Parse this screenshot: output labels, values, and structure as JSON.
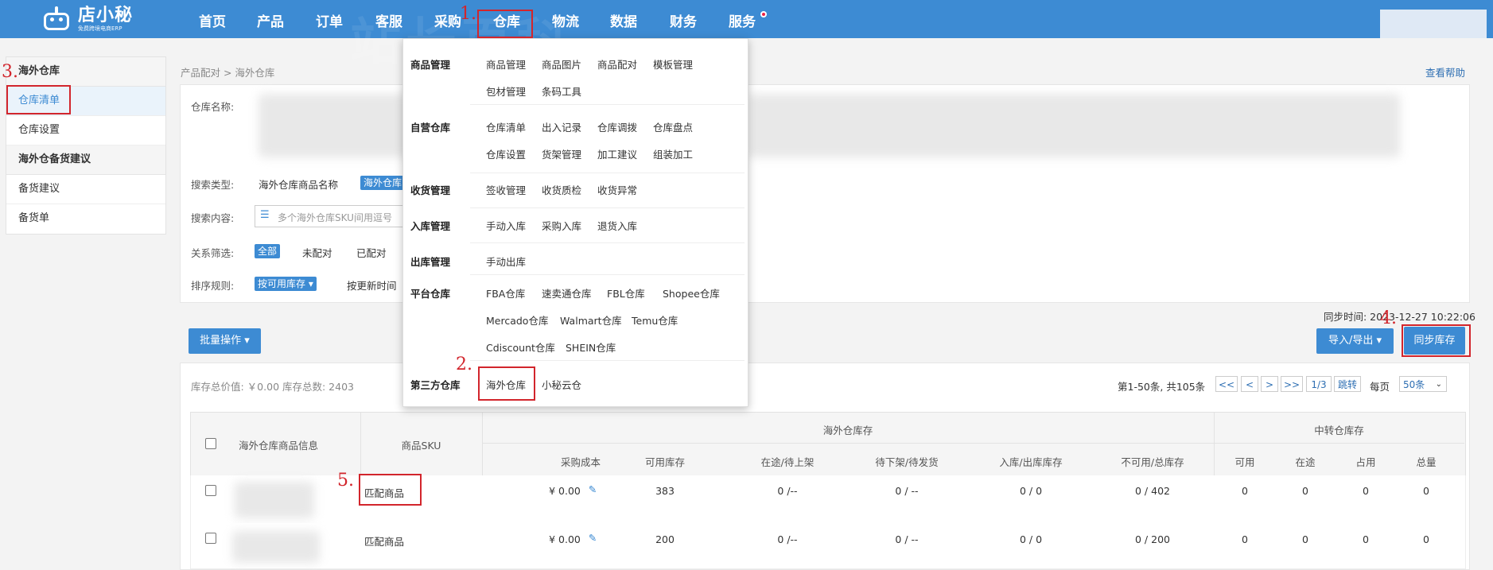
{
  "app": {
    "logo_name": "店小秘",
    "logo_tagline": "免费跨境电商ERP"
  },
  "nav": {
    "items": [
      "首页",
      "产品",
      "订单",
      "客服",
      "采购",
      "仓库",
      "物流",
      "数据",
      "财务",
      "服务"
    ],
    "active": "仓库"
  },
  "annotations": [
    "1.",
    "2.",
    "3.",
    "4.",
    "5."
  ],
  "sidebar": {
    "group1_title": "海外仓库",
    "group1_items": [
      "仓库清单",
      "仓库设置"
    ],
    "group2_title": "海外仓备货建议",
    "group2_items": [
      "备货建议",
      "备货单"
    ]
  },
  "breadcrumb": "产品配对 > 海外仓库",
  "help_link": "查看帮助",
  "filters": {
    "warehouse_name_label": "仓库名称:",
    "search_type_label": "搜索类型:",
    "search_type_option1": "海外仓库商品名称",
    "search_type_option2": "海外仓库",
    "search_content_label": "搜索内容:",
    "search_placeholder": "多个海外仓库SKU间用逗号",
    "relation_label": "关系筛选:",
    "relation_options": [
      "全部",
      "未配对",
      "已配对"
    ],
    "sort_label": "排序规则:",
    "sort_selected": "按可用库存 ▾",
    "sort_option2": "按更新时间"
  },
  "sync_time": "同步时间: 2023-12-27 10:22:06",
  "actions": {
    "batch": "批量操作 ▾",
    "import_export": "导入/导出 ▾",
    "sync_stock": "同步库存"
  },
  "summary": "库存总价值: ￥0.00 库存总数: 2403",
  "pager": {
    "range": "第1-50条, 共105条",
    "buttons": [
      "<<",
      "<",
      ">",
      ">>",
      "1/3",
      "跳转"
    ],
    "per_page_label": "每页",
    "per_page_value": "50条"
  },
  "dropdown": {
    "categories": [
      {
        "name": "商品管理",
        "items": [
          "商品管理",
          "商品图片",
          "商品配对",
          "模板管理",
          "包材管理",
          "条码工具"
        ]
      },
      {
        "name": "自营仓库",
        "items": [
          "仓库清单",
          "出入记录",
          "仓库调拨",
          "仓库盘点",
          "仓库设置",
          "货架管理",
          "加工建议",
          "组装加工"
        ]
      },
      {
        "name": "收货管理",
        "items": [
          "签收管理",
          "收货质检",
          "收货异常"
        ]
      },
      {
        "name": "入库管理",
        "items": [
          "手动入库",
          "采购入库",
          "退货入库"
        ]
      },
      {
        "name": "出库管理",
        "items": [
          "手动出库"
        ]
      },
      {
        "name": "平台仓库",
        "items": [
          "FBA仓库",
          "速卖通仓库",
          "FBL仓库",
          "Shopee仓库",
          "Mercado仓库",
          "Walmart仓库",
          "Temu仓库",
          "Cdiscount仓库",
          "SHEIN仓库"
        ]
      },
      {
        "name": "第三方仓库",
        "items": [
          "海外仓库",
          "小秘云仓"
        ]
      }
    ]
  },
  "table": {
    "headers": {
      "product_info": "海外仓库商品信息",
      "product_sku": "商品SKU",
      "overseas_group": "海外仓库存",
      "transit_group": "中转仓库存",
      "overseas_cols": [
        "采购成本",
        "可用库存",
        "在途/待上架",
        "待下架/待发货",
        "入库/出库库存",
        "不可用/总库存"
      ],
      "transit_cols": [
        "可用",
        "在途",
        "占用",
        "总量"
      ]
    },
    "rows": [
      {
        "sku_link": "匹配商品",
        "cost": "¥ 0.00",
        "available": "383",
        "in_transit": "0 /--",
        "pending": "0 / --",
        "in_out": "0 / 0",
        "unavailable_total": "0 / 402",
        "t_available": "0",
        "t_transit": "0",
        "t_occupied": "0",
        "t_total": "0"
      },
      {
        "sku_link": "匹配商品",
        "cost": "¥ 0.00",
        "available": "200",
        "in_transit": "0 /--",
        "pending": "0 / --",
        "in_out": "0 / 0",
        "unavailable_total": "0 / 200",
        "t_available": "0",
        "t_transit": "0",
        "t_occupied": "0",
        "t_total": "0"
      }
    ]
  }
}
